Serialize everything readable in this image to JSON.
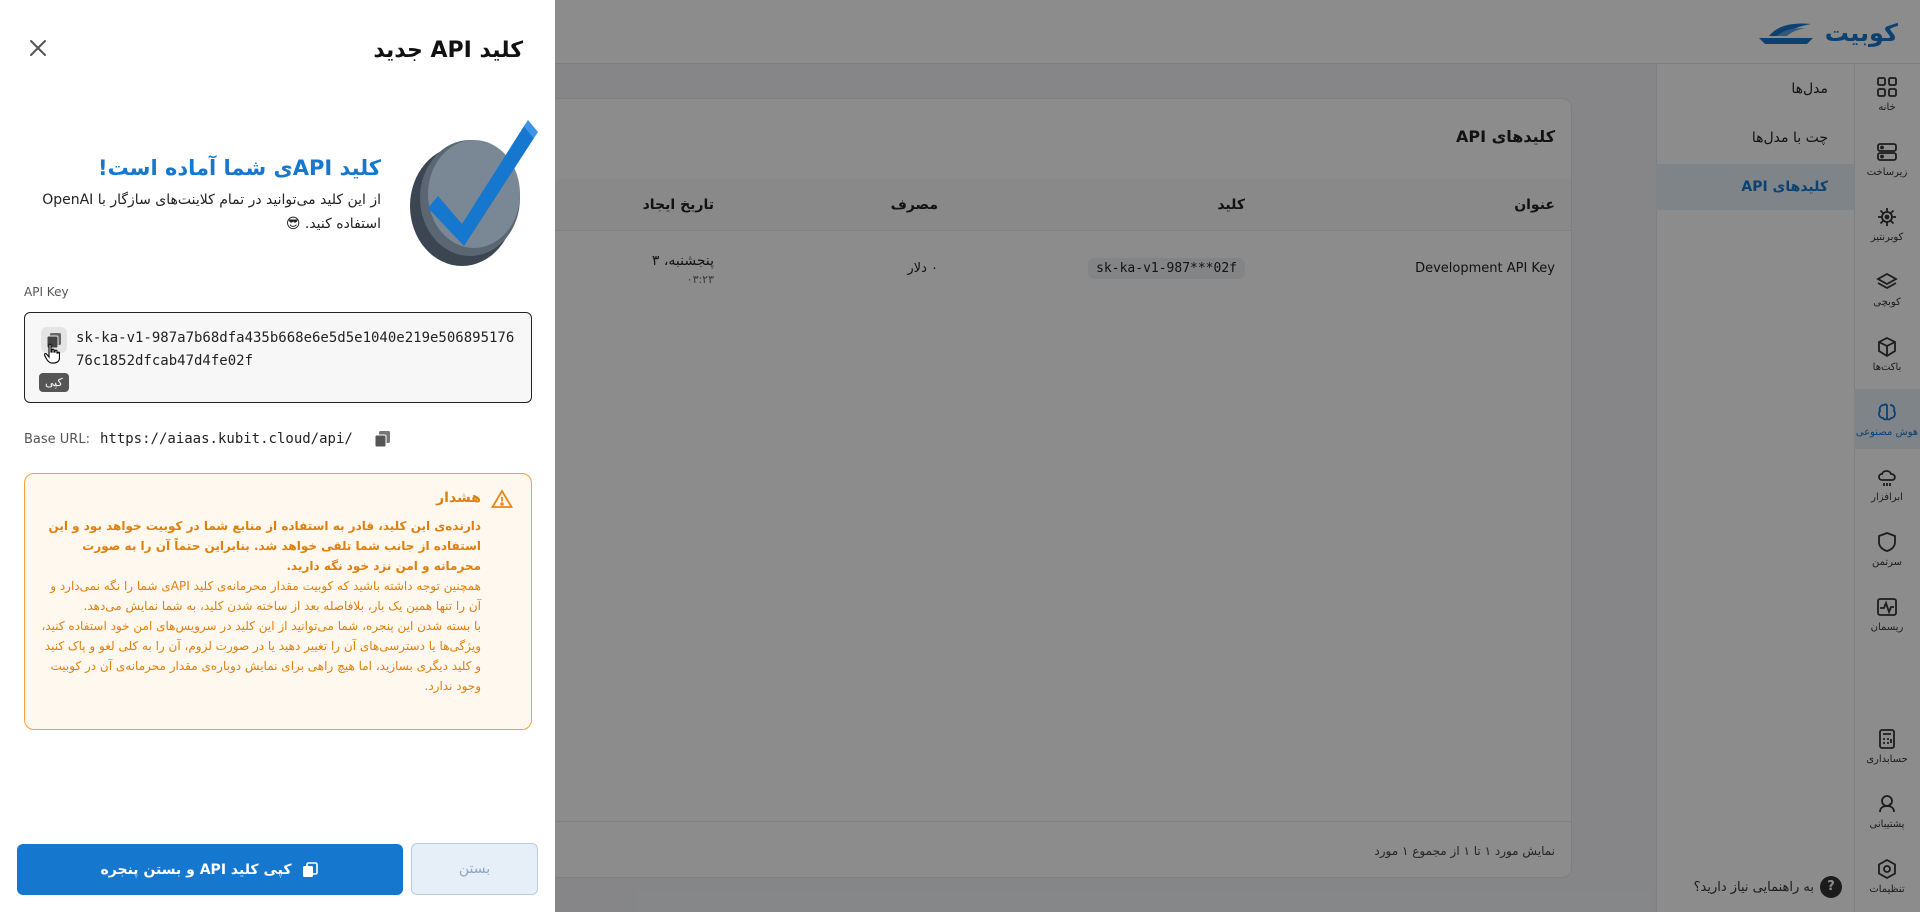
{
  "app": {
    "brand": "کوبیت",
    "rail": [
      {
        "label": "خانه",
        "icon": "grid-icon"
      },
      {
        "label": "زیرساخت",
        "icon": "server-icon"
      },
      {
        "label": "کوبرنتیز",
        "icon": "helm-icon"
      },
      {
        "label": "کوبچی",
        "icon": "layers-icon"
      },
      {
        "label": "باکت‌ها",
        "icon": "cube-icon"
      },
      {
        "label": "هوش مصنوعی",
        "icon": "brain-icon"
      },
      {
        "label": "ابرافزار",
        "icon": "cloud-icon"
      },
      {
        "label": "سرتمن",
        "icon": "shield-icon"
      },
      {
        "label": "ریسمان",
        "icon": "pulse-icon"
      }
    ],
    "rail_bottom": [
      {
        "label": "حسابداری",
        "icon": "calculator-icon"
      },
      {
        "label": "پشتیبانی",
        "icon": "headset-icon"
      },
      {
        "label": "تنظیمات",
        "icon": "settings-icon"
      }
    ],
    "subnav": [
      "مدل‌ها",
      "چت با مدل‌ها",
      "کلیدهای API"
    ],
    "help": "به راهنمایی نیاز دارید؟",
    "card_title": "کلیدهای API",
    "columns": [
      "عنوان",
      "کلید",
      "مصرف",
      "تاریخ ایجاد"
    ],
    "row": {
      "title": "Development API Key",
      "key": "sk-ka-v1-987***02f",
      "usage": "۰ دلار",
      "date": "پنجشنبه، ۳",
      "time": "۰۳:۲۳"
    },
    "footer": "نمایش مورد ۱ تا ۱ از مجموع ۱ مورد"
  },
  "drawer": {
    "title": "کلید API جدید",
    "hero_title": "کلید APIی شما آماده است!",
    "hero_desc": "از این کلید می‌توانید در تمام کلاینت‌های سازگار با OpenAI استفاده کنید. 😎",
    "field_label": "API Key",
    "api_key": "sk-ka-v1-987a7b68dfa435b668e6e5d5e1040e219e50689517676c1852dfcab47d4fe02f",
    "copy_tooltip": "کپی",
    "base_label": "Base URL:",
    "base_url": "https://aiaas.kubit.cloud/api/",
    "warning_title": "هشدار",
    "warning_bold": "دارنده‌ی این کلید، قادر به استفاده از منابع شما در کوبیت خواهد بود و این استفاده از جانب شما تلقی خواهد شد. بنابراین حتماً آن را به صورت محرمانه و امن نزد خود نگه دارید.",
    "warning_p1": "همچنین توجه داشته باشید که کوبیت مقدار محرمانه‌ی کلید APIی شما را نگه نمی‌دارد و آن را تنها همین یک بار، بلافاصله بعد از ساخته شدن کلید، به شما نمایش می‌دهد.",
    "warning_p2": "با بسته شدن این پنجره، شما می‌توانید از این کلید در سرویس‌های امن خود استفاده کنید، ویژگی‌ها یا دسترسی‌های آن را تغییر دهید یا در صورت لزوم، آن را به کلی لغو و پاک کنید و کلید دیگری بسازید، اما هیچ راهی برای نمایش دوباره‌ی مقدار محرمانه‌ی آن در کوبیت وجود ندارد.",
    "primary_button": "کپی کلید API و بستن پنجره",
    "secondary_button": "بستن"
  },
  "colors": {
    "accent": "#1677cf",
    "warning": "#f5a23c"
  }
}
